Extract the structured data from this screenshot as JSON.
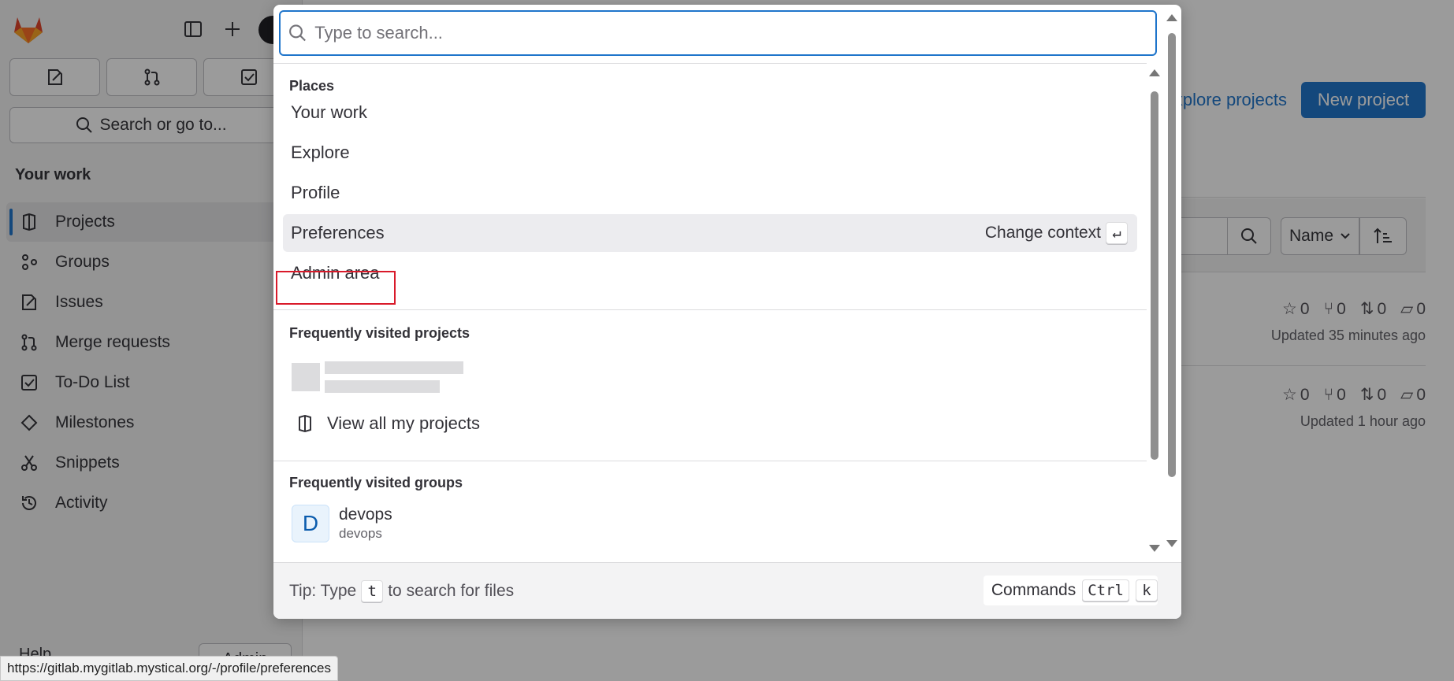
{
  "sidebar": {
    "search_label": "Search or go to...",
    "section_title": "Your work",
    "items": [
      {
        "label": "Projects"
      },
      {
        "label": "Groups"
      },
      {
        "label": "Issues"
      },
      {
        "label": "Merge requests"
      },
      {
        "label": "To-Do List"
      },
      {
        "label": "Milestones"
      },
      {
        "label": "Snippets"
      },
      {
        "label": "Activity"
      }
    ],
    "help_label": "Help",
    "admin_label": "Admin"
  },
  "main": {
    "explore_link": "Explore projects",
    "new_project_label": "New project",
    "sort_label": "Name",
    "projects": [
      {
        "stars": "0",
        "forks": "0",
        "merge_requests": "0",
        "issues": "0",
        "updated": "Updated 35 minutes ago"
      },
      {
        "stars": "0",
        "forks": "0",
        "merge_requests": "0",
        "issues": "0",
        "updated": "Updated 1 hour ago"
      }
    ]
  },
  "palette": {
    "search_placeholder": "Type to search...",
    "places_title": "Places",
    "places": [
      {
        "label": "Your work"
      },
      {
        "label": "Explore"
      },
      {
        "label": "Profile"
      },
      {
        "label": "Preferences"
      },
      {
        "label": "Admin area"
      }
    ],
    "hover_hint": "Change context",
    "hover_hint_key": "↵",
    "projects_title": "Frequently visited projects",
    "view_all_label": "View all my projects",
    "groups_title": "Frequently visited groups",
    "groups": [
      {
        "avatar_letter": "D",
        "name": "devops",
        "path": "devops"
      }
    ],
    "footer": {
      "tip_prefix": "Tip: Type",
      "tip_key": "t",
      "tip_suffix": "to search for files",
      "commands_label": "Commands",
      "commands_key1": "Ctrl",
      "commands_key2": "k"
    }
  },
  "status_bar": {
    "url": "https://gitlab.mygitlab.mystical.org/-/profile/preferences"
  },
  "colors": {
    "accent": "#1f75cb",
    "highlight_box": "#d91a2a",
    "logo_orange": "#e24329"
  }
}
